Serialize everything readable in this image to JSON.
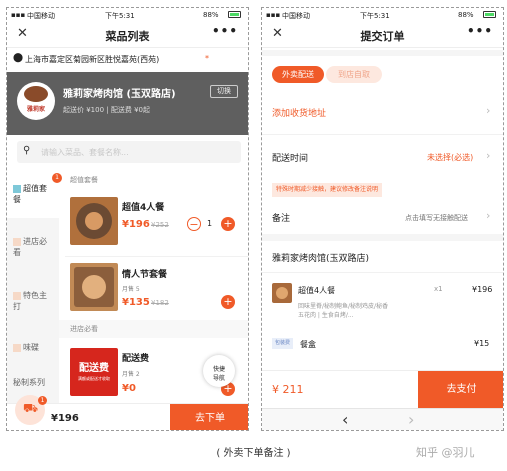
{
  "phone1": {
    "status": {
      "carrier": "中国移动",
      "time": "下午5:31",
      "battery": "88%"
    },
    "nav": {
      "title": "菜品列表",
      "close": "✕",
      "more": "•••"
    },
    "address": {
      "text": "上海市嘉定区菊园新区胜悦嘉苑(西苑)",
      "mark": "*"
    },
    "shop": {
      "name": "雅莉家烤肉馆 (玉双路店)",
      "info": "起送价 ¥100 | 配送费 ¥0起",
      "switch": "切换",
      "logo_text": "雅莉家"
    },
    "search": {
      "placeholder": "请输入菜品、套餐名称..."
    },
    "sidebar": [
      {
        "label": "超值套餐",
        "badge": "1"
      },
      {
        "label": "进店必看"
      },
      {
        "label": "特色主打"
      },
      {
        "label": "味碟"
      },
      {
        "label": "秘制系列"
      }
    ],
    "section1": "超值套餐",
    "items": [
      {
        "name": "超值4人餐",
        "price": "¥196",
        "old_price": "¥252",
        "qty": "1"
      },
      {
        "name": "情人节套餐",
        "sales": "月售 5",
        "price": "¥135",
        "old_price": "¥182"
      }
    ],
    "section2": "进店必看",
    "item3": {
      "name": "配送费",
      "sales": "月售 2",
      "price": "¥0",
      "img_text": "配送费",
      "img_sub": "满额或配送才收取"
    },
    "nav_float": {
      "line1": "快捷",
      "line2": "导航"
    },
    "cart": {
      "total": "¥196",
      "badge": "1",
      "button": "去下单"
    }
  },
  "phone2": {
    "status": {
      "carrier": "中国移动",
      "time": "下午5:31",
      "battery": "88%"
    },
    "nav": {
      "title": "提交订单",
      "close": "✕",
      "more": "•••"
    },
    "tabs": {
      "delivery": "外卖配送",
      "pickup": "到店自取"
    },
    "add_address": "添加收货地址",
    "delivery_time": {
      "label": "配送时间",
      "value": "未选择(必选)"
    },
    "notice": "特殊时期减少接触，建议修改备注说明",
    "remark": {
      "label": "备注",
      "value": "点击填写无接触配送"
    },
    "shop_name": "雅莉家烤肉馆(玉双路店)",
    "order_item": {
      "name": "超值4人餐",
      "qty": "x1",
      "price": "¥196",
      "desc": "回味里脊/秘制鲍鱼/秘制鸡皮/秘香五花肉 | 生食自烤/..."
    },
    "fee": {
      "tag": "包装费",
      "name": "餐盒",
      "price": "¥15"
    },
    "bottom": {
      "total": "¥ 211",
      "button": "去支付"
    },
    "browser": {
      "back": "‹",
      "forward": "›"
    }
  },
  "caption": "( 外卖下单备注 )",
  "watermark": "知乎 @羽儿",
  "colors": {
    "accent": "#f05a28",
    "shop_banner": "#5f5f5f"
  }
}
